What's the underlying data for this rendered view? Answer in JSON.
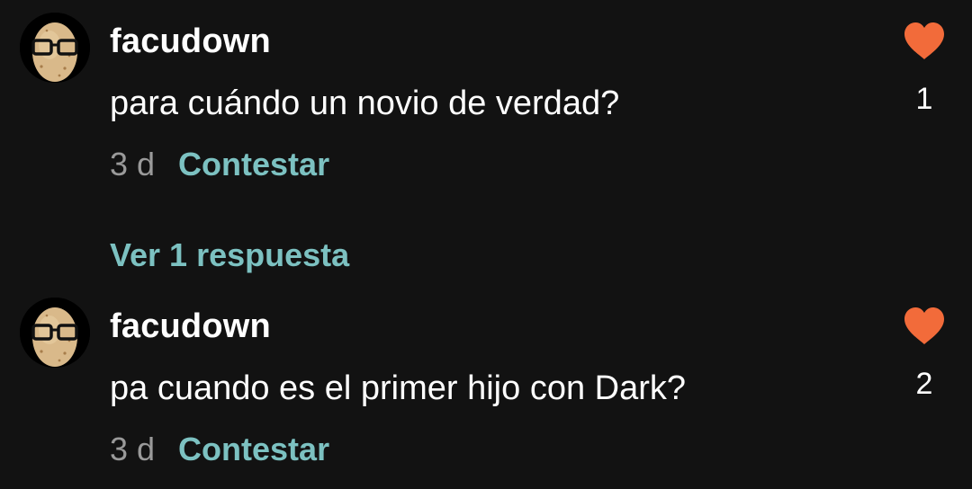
{
  "colors": {
    "background": "#121212",
    "username": "#ffffff",
    "comment_text": "#ffffff",
    "timestamp": "#9a9a9a",
    "accent": "#7cc1c1",
    "heart": "#f26b3a"
  },
  "comments": [
    {
      "avatar_icon": "potato-with-glasses-avatar",
      "username": "facudown",
      "text": "para cuándo un novio de verdad?",
      "age": "3 d",
      "reply_label": "Contestar",
      "like_icon": "heart-icon",
      "like_count": "1"
    },
    {
      "avatar_icon": "potato-with-glasses-avatar",
      "username": "facudown",
      "text": "pa cuando es el primer hijo con Dark?",
      "age": "3 d",
      "reply_label": "Contestar",
      "like_icon": "heart-icon",
      "like_count": "2"
    }
  ],
  "view_replies_label": "Ver 1 respuesta"
}
